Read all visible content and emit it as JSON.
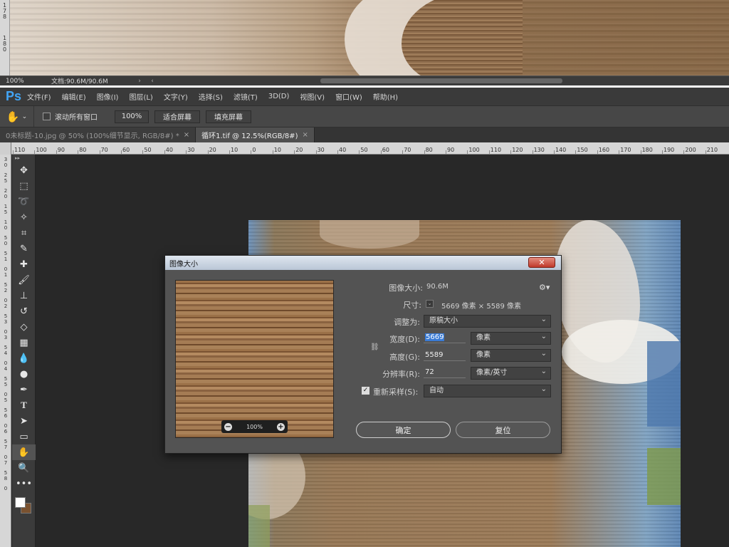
{
  "top_window": {
    "ruler_digits": [
      "1",
      "7",
      "8",
      "",
      "1",
      "8",
      "0"
    ],
    "zoom": "100%",
    "doc_info": "文档:90.6M/90.6M",
    "nav_next": "›",
    "nav_prev": "‹"
  },
  "menubar": {
    "logo": "Ps",
    "items": [
      "文件(F)",
      "编辑(E)",
      "图像(I)",
      "图层(L)",
      "文字(Y)",
      "选择(S)",
      "滤镜(T)",
      "3D(D)",
      "视图(V)",
      "窗口(W)",
      "帮助(H)"
    ]
  },
  "options": {
    "scroll_all_label": "滚动所有窗口",
    "zoom_value": "100%",
    "fit_screen": "适合屏幕",
    "fill_screen": "填充屏幕"
  },
  "tabs": [
    {
      "label": "0未标题-10.jpg @ 50% (100%细节显示, RGB/8#) *",
      "close": "×"
    },
    {
      "label": "循环1.tif @ 12.5%(RGB/8#)",
      "close": "×"
    }
  ],
  "ruler_h": [
    "110",
    "100",
    "90",
    "80",
    "70",
    "60",
    "50",
    "40",
    "30",
    "20",
    "10",
    "0",
    "10",
    "20",
    "30",
    "40",
    "50",
    "60",
    "70",
    "80",
    "90",
    "100",
    "110",
    "120",
    "130",
    "140",
    "150",
    "160",
    "170",
    "180",
    "190",
    "200",
    "210"
  ],
  "ruler_v": [
    "3",
    "0",
    "2",
    "5",
    "2",
    "0",
    "1",
    "5",
    "1",
    "0",
    "5",
    "0",
    "5",
    "1",
    "0",
    "1",
    "5",
    "2",
    "0",
    "2",
    "5",
    "3",
    "0",
    "3",
    "5",
    "4",
    "0",
    "4",
    "5",
    "5",
    "0",
    "5",
    "5",
    "6",
    "0",
    "6",
    "5",
    "7",
    "0",
    "7",
    "5",
    "8",
    "0"
  ],
  "dialog": {
    "title": "图像大小",
    "close": "✕",
    "zoom_level": "100%",
    "zoom_minus": "−",
    "zoom_plus": "+",
    "image_size_label": "图像大小:",
    "image_size_value": "90.6M",
    "dimensions_label": "尺寸:",
    "dimensions_value": "5669 像素 × 5589 像素",
    "fit_to_label": "调整为:",
    "fit_to_value": "原稿大小",
    "width_label": "宽度(D):",
    "width_value": "5669",
    "width_unit": "像素",
    "height_label": "高度(G):",
    "height_value": "5589",
    "height_unit": "像素",
    "resolution_label": "分辨率(R):",
    "resolution_value": "72",
    "resolution_unit": "像素/英寸",
    "resample_label": "重新采样(S):",
    "resample_value": "自动",
    "ok": "确定",
    "reset": "复位",
    "check": "✓"
  },
  "colors": {
    "accent": "#3a7bd5",
    "ps_blue": "#42a5f5",
    "close_red": "#c0392b"
  }
}
